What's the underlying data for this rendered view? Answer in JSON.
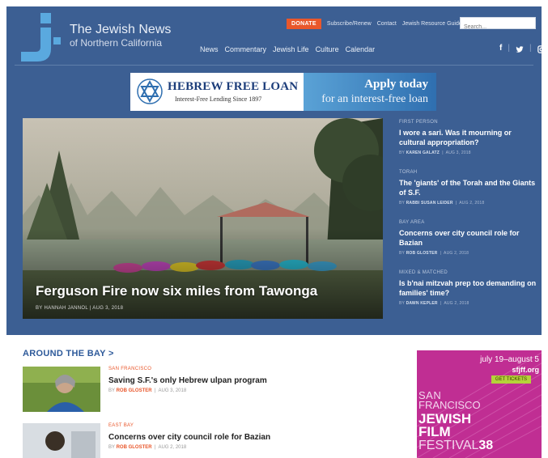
{
  "site": {
    "title_line1": "The Jewish News",
    "title_line2": "of Northern California"
  },
  "toplinks": {
    "donate": "DONATE",
    "subscribe": "Subscribe/Renew",
    "contact": "Contact",
    "resource": "Jewish Resource Guide"
  },
  "search": {
    "placeholder": "Search..."
  },
  "nav": [
    "News",
    "Commentary",
    "Jewish Life",
    "Culture",
    "Calendar"
  ],
  "social": {
    "facebook": "f",
    "twitter": "t",
    "instagram": "i"
  },
  "banner": {
    "title": "HEBREW FREE LOAN",
    "subtitle": "Interest-Free Lending Since 1897",
    "apply": "Apply today",
    "apply_sub": "for an interest-free loan"
  },
  "hero": {
    "title": "Ferguson Fire now six miles from Tawonga",
    "byline": "BY HANNAH JANNOL  |  AUG 3, 2018"
  },
  "side_stories": [
    {
      "kicker": "FIRST PERSON",
      "title": "I wore a sari. Was it mourning or cultural appropriation?",
      "by_prefix": "BY",
      "author": "KAREN GALATZ",
      "date": "AUG 3, 2018"
    },
    {
      "kicker": "TORAH",
      "title": "The 'giants' of the Torah and the Giants of S.F.",
      "by_prefix": "BY",
      "author": "RABBI SUSAN LEIDER",
      "date": "AUG 2, 2018"
    },
    {
      "kicker": "BAY AREA",
      "title": "Concerns over city council role for Bazian",
      "by_prefix": "BY",
      "author": "ROB GLOSTER",
      "date": "AUG 2, 2018"
    },
    {
      "kicker": "MIXED & MATCHED",
      "title": "Is b'nai mitzvah prep too demanding on families' time?",
      "by_prefix": "BY",
      "author": "DAWN KEPLER",
      "date": "AUG 2, 2018"
    }
  ],
  "around_the_bay": {
    "heading": "AROUND THE BAY",
    "arrow": ">",
    "stories": [
      {
        "kicker": "SAN FRANCISCO",
        "title": "Saving S.F.'s only Hebrew ulpan program",
        "by_prefix": "BY",
        "author": "ROB GLOSTER",
        "date": "AUG 3, 2018"
      },
      {
        "kicker": "EAST BAY",
        "title": "Concerns over city council role for Bazian",
        "by_prefix": "BY",
        "author": "ROB GLOSTER",
        "date": "AUG 2, 2018"
      }
    ]
  },
  "fest_ad": {
    "dates": "july 19–august 5",
    "url": "sfjff.org",
    "button": "GET TICKETS",
    "line1": "SAN",
    "line2": "FRANCISCO",
    "line3": "JEWISH",
    "line4": "FILM",
    "line5": "FESTIVAL",
    "number": "38"
  },
  "colors": {
    "brand_blue": "#3c5f93",
    "accent_orange": "#e9572b",
    "link_blue": "#2e5a9a",
    "fest_magenta": "#c02e93"
  }
}
